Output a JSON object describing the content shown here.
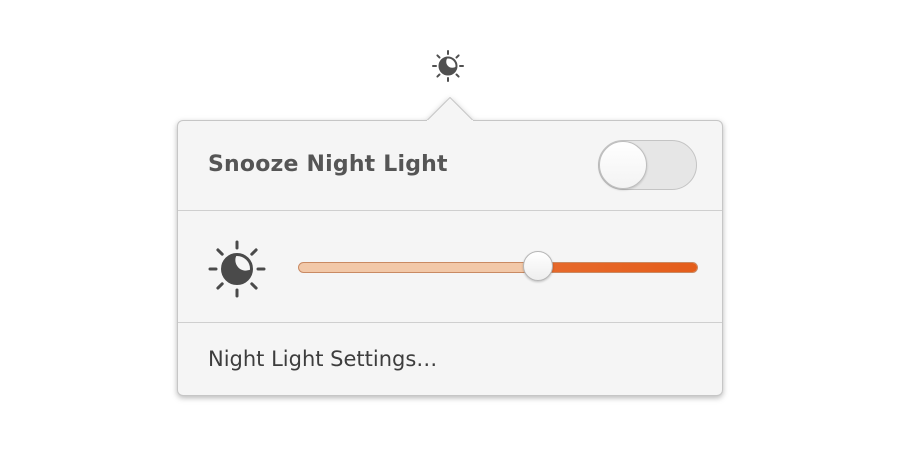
{
  "indicator": {
    "icon": "night-light-icon"
  },
  "popover": {
    "snooze": {
      "label": "Snooze Night Light",
      "toggle_on": false
    },
    "temperature": {
      "icon": "night-light-icon",
      "level": 0.6
    },
    "settings": {
      "label": "Night Light Settings…"
    }
  },
  "colors": {
    "accent": "#e45d1a",
    "track_light": "#f2c8a8",
    "popover_bg": "#f5f5f5",
    "text": "#555555"
  }
}
